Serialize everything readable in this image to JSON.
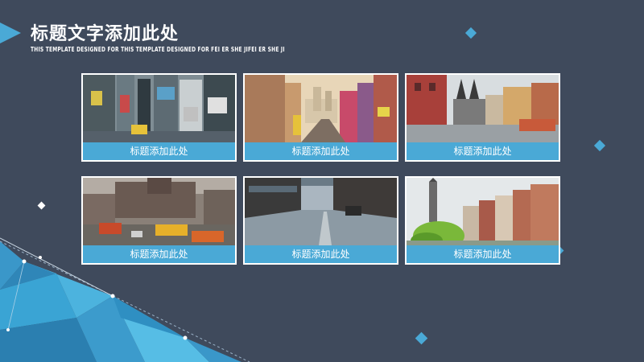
{
  "slide": {
    "title": "标题文字添加此处",
    "subtitle": "THIS TEMPLATE DESIGNED FOR THIS TEMPLATE DESIGNED FOR FEI ER SHE JIFEI ER SHE JI"
  },
  "cards": [
    {
      "caption": "标题添加此处",
      "image": "times-square-street-photo"
    },
    {
      "caption": "标题添加此处",
      "image": "city-street-sunset-photo"
    },
    {
      "caption": "标题添加此处",
      "image": "old-town-square-photo"
    },
    {
      "caption": "标题添加此处",
      "image": "rainy-street-buses-photo"
    },
    {
      "caption": "标题添加此处",
      "image": "cobblestone-street-photo"
    },
    {
      "caption": "标题添加此处",
      "image": "canal-houses-tower-photo"
    }
  ],
  "colors": {
    "background": "#3f4a5c",
    "accent": "#4aa9d6",
    "accent_light": "#6cc3ea"
  }
}
